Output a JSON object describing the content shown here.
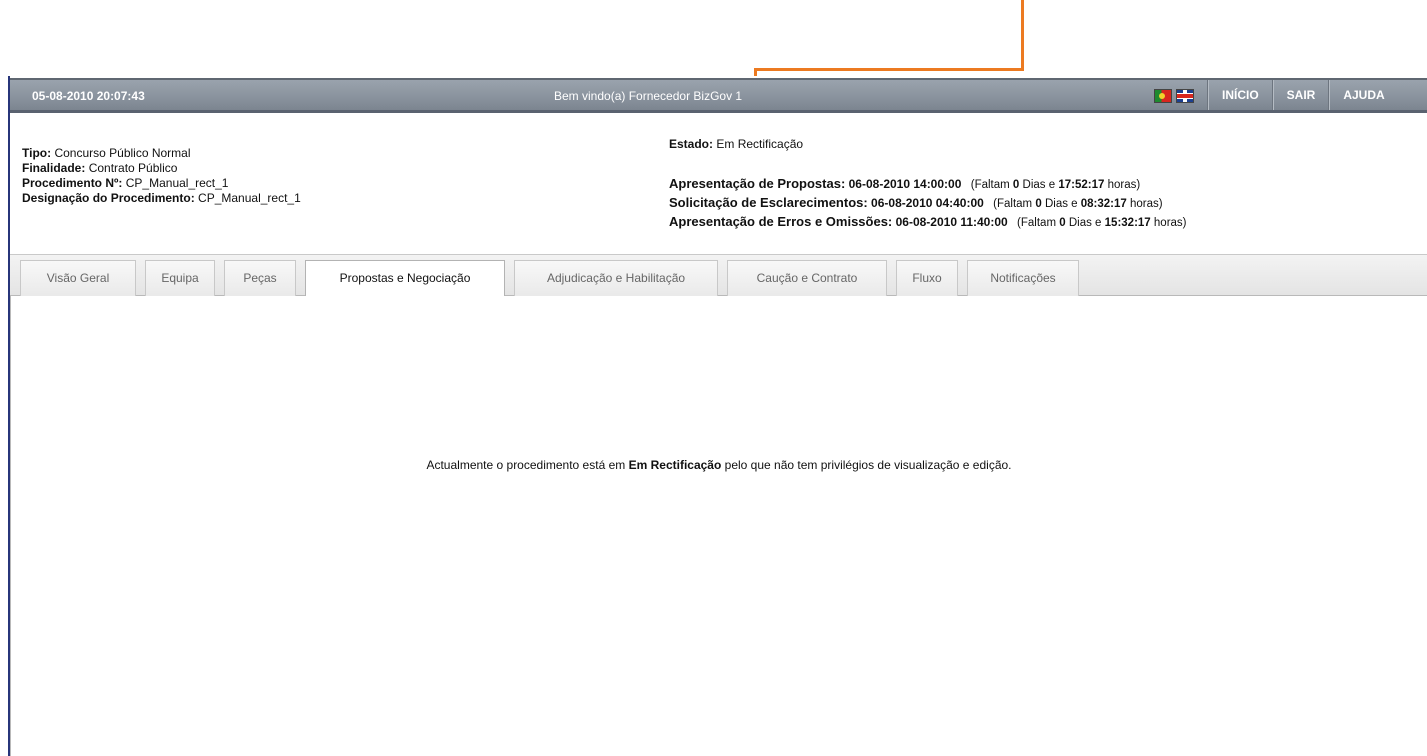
{
  "header": {
    "datetime": "05-08-2010 20:07:43",
    "welcome": "Bem vindo(a) Fornecedor BizGov 1",
    "nav": [
      {
        "label": "INÍCIO"
      },
      {
        "label": "SAIR"
      },
      {
        "label": "AJUDA"
      }
    ],
    "languages": [
      "pt-flag-icon",
      "uk-flag-icon"
    ]
  },
  "procedure": {
    "tipo_label": "Tipo:",
    "tipo": "Concurso Público Normal",
    "finalidade_label": "Finalidade:",
    "finalidade": "Contrato Público",
    "numero_label": "Procedimento Nº:",
    "numero": "CP_Manual_rect_1",
    "designacao_label": "Designação do Procedimento:",
    "designacao": "CP_Manual_rect_1"
  },
  "estado": {
    "label": "Estado:",
    "value": "Em Rectificação"
  },
  "deadlines": [
    {
      "label": "Apresentação de Propostas:",
      "datetime": "06-08-2010 14:00:00",
      "pre": "(Faltam",
      "days": "0",
      "mid": "Dias e",
      "time": "17:52:17",
      "post": "horas)"
    },
    {
      "label": "Solicitação de Esclarecimentos:",
      "datetime": "06-08-2010 04:40:00",
      "pre": "(Faltam",
      "days": "0",
      "mid": "Dias e",
      "time": "08:32:17",
      "post": "horas)"
    },
    {
      "label": "Apresentação de Erros e Omissões:",
      "datetime": "06-08-2010 11:40:00",
      "pre": "(Faltam",
      "days": "0",
      "mid": "Dias e",
      "time": "15:32:17",
      "post": "horas)"
    }
  ],
  "tabs": [
    {
      "label": "Visão Geral"
    },
    {
      "label": "Equipa"
    },
    {
      "label": "Peças"
    },
    {
      "label": "Propostas e Negociação",
      "active": true
    },
    {
      "label": "Adjudicação e Habilitação"
    },
    {
      "label": "Caução e Contrato"
    },
    {
      "label": "Fluxo"
    },
    {
      "label": "Notificações"
    }
  ],
  "message": {
    "before": "Actualmente o procedimento está em",
    "state": "Em Rectificação",
    "after": "pelo que não tem privilégios de visualização e edição."
  },
  "colors": {
    "annotation_arrow": "#ec7a21",
    "annotation_box": "#e5001e",
    "topbar": "#8a939e"
  }
}
